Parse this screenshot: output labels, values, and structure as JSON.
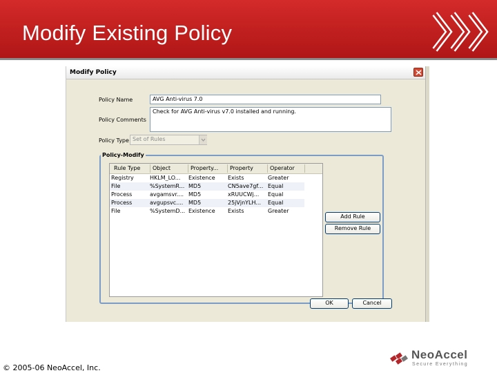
{
  "slide": {
    "title": "Modify Existing Policy",
    "footer": "© 2005-06 NeoAccel, Inc.",
    "logo_word": "NeoAccel",
    "logo_tagline": "Secure Everything",
    "banner_color": "#c21e1e"
  },
  "dialog": {
    "title": "Modify Policy",
    "policy_name_label": "Policy Name",
    "policy_name_value": "AVG Anti-virus 7.0",
    "policy_comments_label": "Policy Comments",
    "policy_comments_value": "Check for AVG Anti-virus v7.0 installed and running.",
    "policy_type_label": "Policy Type",
    "policy_type_value": "Set of Rules",
    "group_label": "Policy-Modify",
    "columns": [
      "Rule Type",
      "Object",
      "Property...",
      "Property",
      "Operator"
    ],
    "rows": [
      [
        "Registry",
        "HKLM_LO...",
        "Existence",
        "Exists",
        "Greater"
      ],
      [
        "File",
        "%SystemR...",
        "MD5",
        "CN5ave7gf...",
        "Equal"
      ],
      [
        "Process",
        "avgamsvr....",
        "MD5",
        "xRUUCWj...",
        "Equal"
      ],
      [
        "Process",
        "avgupsvc....",
        "MD5",
        "25jVjnYLH...",
        "Equal"
      ],
      [
        "File",
        "%SystemD...",
        "Existence",
        "Exists",
        "Greater"
      ]
    ],
    "add_rule_label": "Add Rule",
    "remove_rule_label": "Remove Rule",
    "ok_label": "OK",
    "cancel_label": "Cancel"
  }
}
